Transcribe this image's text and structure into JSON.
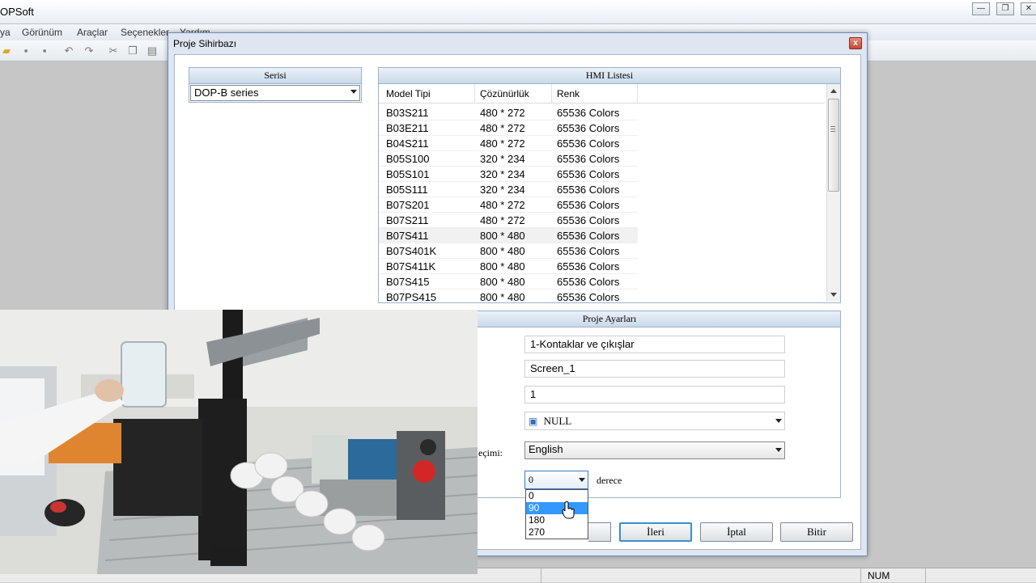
{
  "app": {
    "title": "OPSoft"
  },
  "window_buttons": [
    "minimize-icon",
    "restore-icon",
    "close-icon"
  ],
  "menu": [
    "ya",
    "Görünüm",
    "Araçlar",
    "Seçenekler",
    "Yardım"
  ],
  "dialog": {
    "title": "Proje Sihirbazı",
    "close_label": "x",
    "series": {
      "header": "Serisi",
      "selected": "DOP-B series"
    },
    "hmi": {
      "header": "HMI Listesi",
      "columns": [
        "Model Tipi",
        "Çözünürlük",
        "Renk"
      ],
      "rows": [
        [
          "B03S211",
          "480 * 272",
          "65536 Colors"
        ],
        [
          "B03E211",
          "480 * 272",
          "65536 Colors"
        ],
        [
          "B04S211",
          "480 * 272",
          "65536 Colors"
        ],
        [
          "B05S100",
          "320 * 234",
          "65536 Colors"
        ],
        [
          "B05S101",
          "320 * 234",
          "65536 Colors"
        ],
        [
          "B05S111",
          "320 * 234",
          "65536 Colors"
        ],
        [
          "B07S201",
          "480 * 272",
          "65536 Colors"
        ],
        [
          "B07S211",
          "480 * 272",
          "65536 Colors"
        ],
        [
          "B07S411",
          "800 * 480",
          "65536 Colors"
        ],
        [
          "B07S401K",
          "800 * 480",
          "65536 Colors"
        ],
        [
          "B07S411K",
          "800 * 480",
          "65536 Colors"
        ],
        [
          "B07S415",
          "800 * 480",
          "65536 Colors"
        ],
        [
          "B07PS415",
          "800 * 480",
          "65536 Colors"
        ]
      ],
      "selected_row_index": 8
    },
    "settings": {
      "header": "Proje Ayarları",
      "project_name": "1-Kontaklar ve çıkışlar",
      "screen_name": "Screen_1",
      "screen_number": "1",
      "printer": "NULL",
      "language_label_partial": "eçimi:",
      "language": "English",
      "rotation": "0",
      "rotation_unit": "derece",
      "rotation_options": [
        "0",
        "90",
        "180",
        "270"
      ],
      "rotation_highlighted": "90"
    },
    "buttons": {
      "next": "İleri",
      "cancel": "İptal",
      "finish": "Bitir"
    }
  },
  "status": {
    "num": "NUM"
  },
  "colors": {
    "highlight": "#3399ff",
    "dialog_border": "#6f8fb3"
  }
}
